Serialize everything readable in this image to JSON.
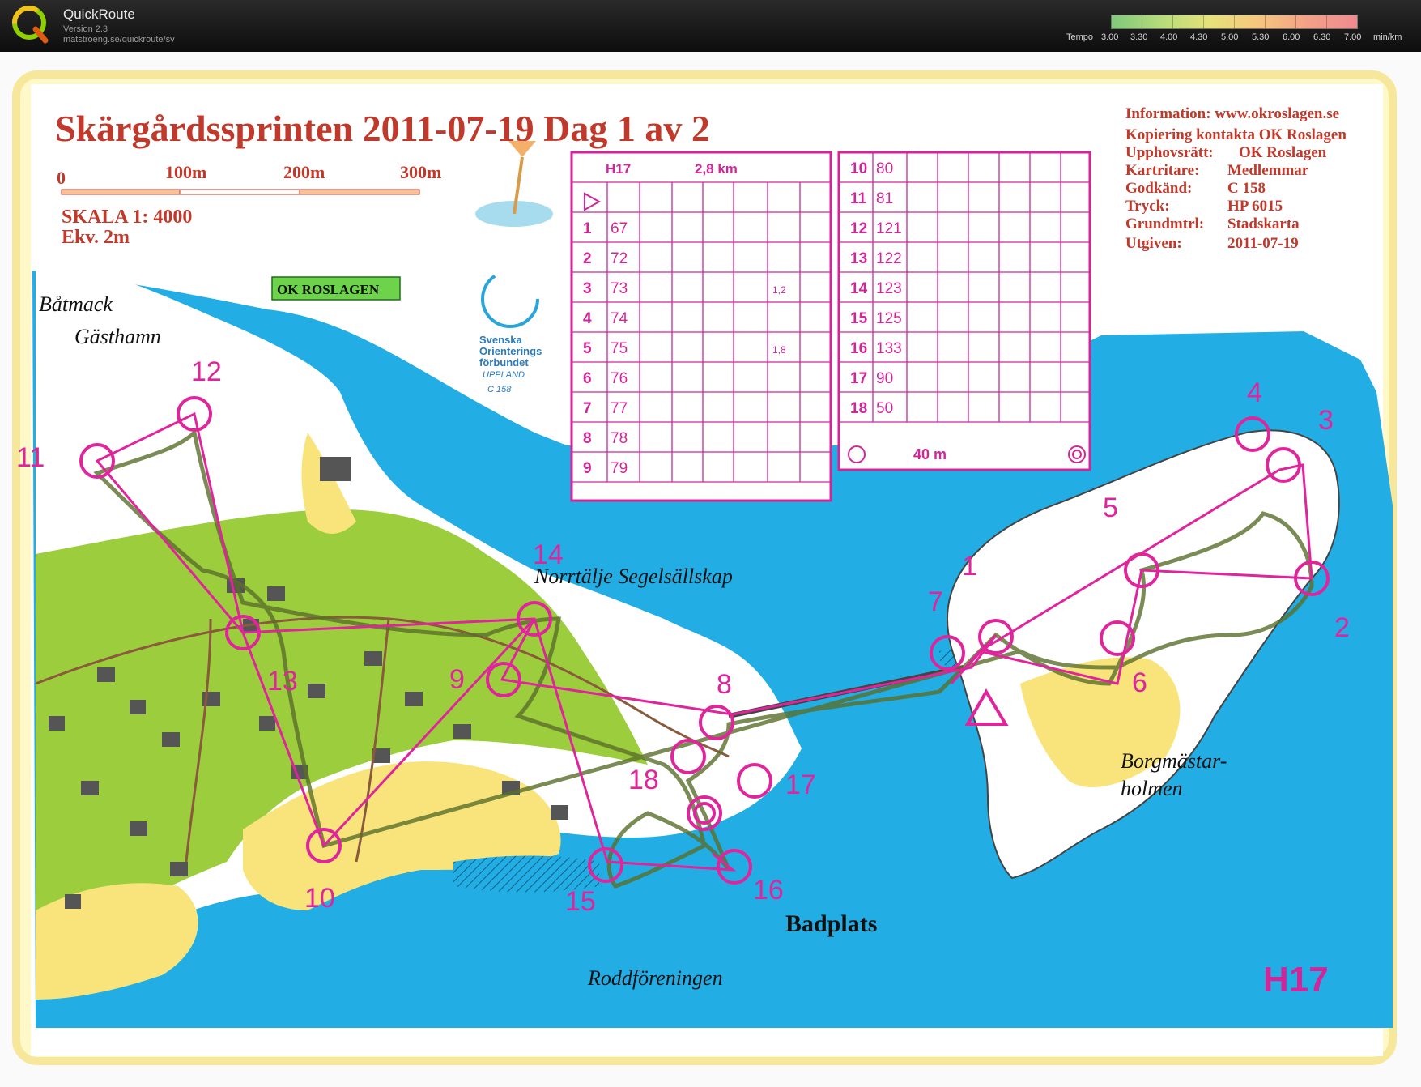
{
  "app": {
    "name": "QuickRoute",
    "version": "Version 2.3",
    "url": "matstroeng.se/quickroute/sv",
    "logo_letter": "Q"
  },
  "tempo_legend": {
    "label": "Tempo",
    "values": [
      "3.00",
      "3.30",
      "4.00",
      "4.30",
      "5.00",
      "5.30",
      "6.00",
      "6.30",
      "7.00"
    ],
    "unit": "min/km",
    "colors": [
      "#7fc97a",
      "#f6c67e",
      "#f08a90"
    ]
  },
  "map": {
    "title": "Skärgårdssprinten 2011-07-19 Dag 1 av 2",
    "scale_labels": [
      "0",
      "100m",
      "200m",
      "300m"
    ],
    "scale_text": "SKALA 1: 4000",
    "equidistance": "Ekv. 2m",
    "club_logo": "OK ROSLAGEN",
    "federation": [
      "Svenska",
      "Orienterings",
      "förbundet",
      "UPPLAND",
      "C 158"
    ],
    "info": [
      {
        "label": "Information: www.okroslagen.se",
        "value": ""
      },
      {
        "label": "Kopiering kontakta OK Roslagen",
        "value": ""
      },
      {
        "label": "Upphovsrätt:",
        "value": "OK Roslagen"
      },
      {
        "label": "Kartritare:",
        "value": "Medlemmar"
      },
      {
        "label": "Godkänd:",
        "value": "C 158"
      },
      {
        "label": "Tryck:",
        "value": "HP 6015"
      },
      {
        "label": "Grundmtrl:",
        "value": "Stadskarta"
      },
      {
        "label": "Utgiven:",
        "value": "2011-07-19"
      }
    ],
    "place_names": [
      "Båtmack",
      "Gästhamn",
      "Norrtälje Segelsällskap",
      "Badplats",
      "Roddföreningen",
      "Borgmästar-",
      "holmen"
    ],
    "class_label": "H17",
    "control_numbers": [
      "1",
      "2",
      "3",
      "4",
      "5",
      "6",
      "7",
      "8",
      "9",
      "10",
      "11",
      "12",
      "13",
      "14",
      "15",
      "16",
      "17",
      "18"
    ],
    "colors": {
      "water": "#22aee5",
      "land": "#ffffff",
      "green": "#9ccd3c",
      "yellow": "#f8e47a",
      "course": "#e0249c",
      "route": "#5a6e2a",
      "title_red": "#c0392b"
    }
  },
  "control_description": {
    "class": "H17",
    "length": "2,8 km",
    "controls": [
      {
        "no": "1",
        "code": "67"
      },
      {
        "no": "2",
        "code": "72"
      },
      {
        "no": "3",
        "code": "73",
        "extra": "1,2"
      },
      {
        "no": "4",
        "code": "74"
      },
      {
        "no": "5",
        "code": "75",
        "extra": "1,8"
      },
      {
        "no": "6",
        "code": "76"
      },
      {
        "no": "7",
        "code": "77"
      },
      {
        "no": "8",
        "code": "78"
      },
      {
        "no": "9",
        "code": "79"
      },
      {
        "no": "10",
        "code": "80"
      },
      {
        "no": "11",
        "code": "81"
      },
      {
        "no": "12",
        "code": "121"
      },
      {
        "no": "13",
        "code": "122"
      },
      {
        "no": "14",
        "code": "123"
      },
      {
        "no": "15",
        "code": "125"
      },
      {
        "no": "16",
        "code": "133"
      },
      {
        "no": "17",
        "code": "90"
      },
      {
        "no": "18",
        "code": "50"
      }
    ],
    "finish_distance": "40 m"
  }
}
